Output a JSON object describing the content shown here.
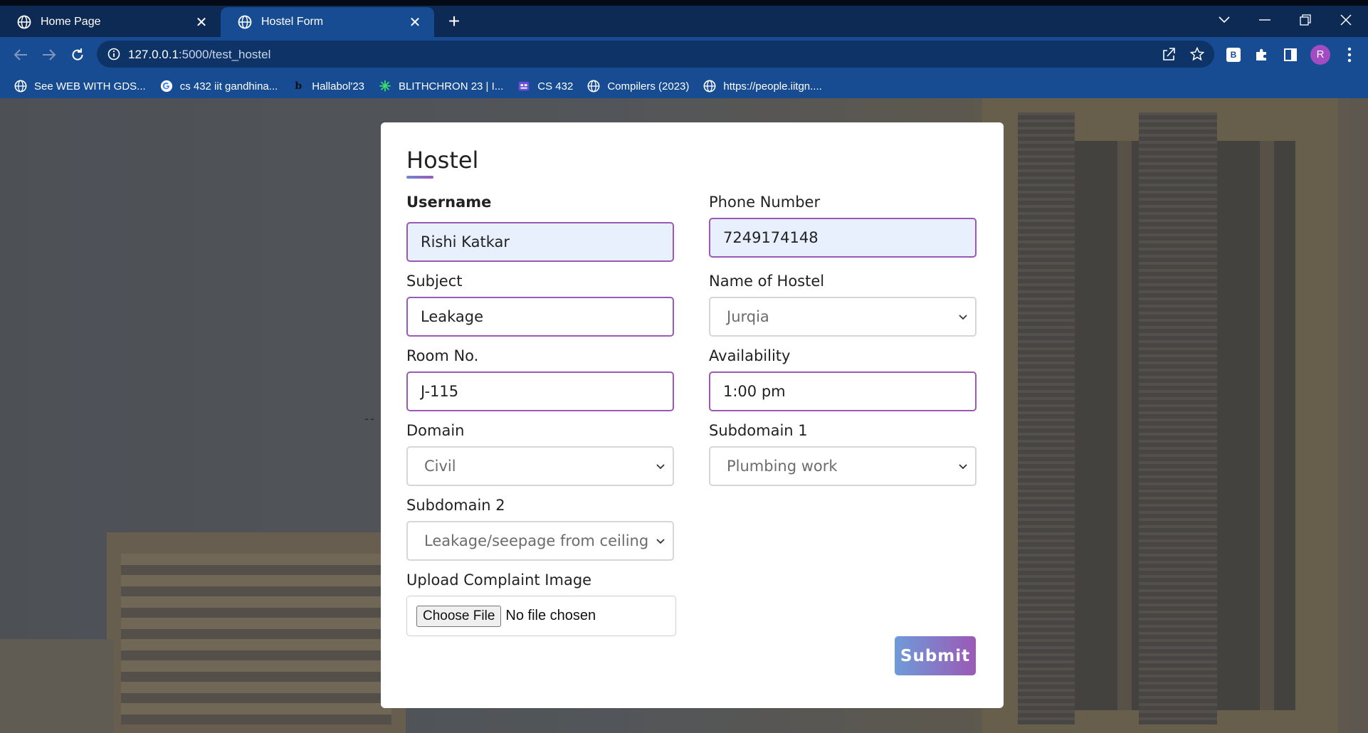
{
  "browser": {
    "tabs": [
      {
        "title": "Home Page",
        "active": false
      },
      {
        "title": "Hostel Form",
        "active": true
      }
    ],
    "url_host": "127.0.0.1",
    "url_rest": ":5000/test_hostel",
    "profile_initial": "R",
    "extension_badge": "B",
    "bookmarks": [
      {
        "label": "See WEB WITH GDS...",
        "icon": "globe-icon"
      },
      {
        "label": "cs 432 iit gandhina...",
        "icon": "google-icon"
      },
      {
        "label": "Hallabol'23",
        "icon": "b-logo-icon"
      },
      {
        "label": "BLITHCHRON 23 | I...",
        "icon": "star-burst-icon"
      },
      {
        "label": "CS 432",
        "icon": "board-icon"
      },
      {
        "label": "Compilers (2023)",
        "icon": "globe-icon"
      },
      {
        "label": "https://people.iitgn....",
        "icon": "globe-icon"
      }
    ]
  },
  "page": {
    "dashes": "--"
  },
  "form": {
    "title": "Hostel",
    "username_label": "Username",
    "username_value": "Rishi Katkar",
    "phone_label": "Phone Number",
    "phone_value": "7249174148",
    "subject_label": "Subject",
    "subject_value": "Leakage",
    "hostel_label": "Name of Hostel",
    "hostel_value": "Jurqia",
    "room_label": "Room No.",
    "room_value": "J-115",
    "availability_label": "Availability",
    "availability_value": "1:00 pm",
    "domain_label": "Domain",
    "domain_value": "Civil",
    "subdomain1_label": "Subdomain 1",
    "subdomain1_value": "Plumbing work",
    "subdomain2_label": "Subdomain 2",
    "subdomain2_value": "Leakage/seepage from ceiling",
    "upload_label": "Upload Complaint Image",
    "file_button": "Choose File",
    "file_status": "No file chosen",
    "submit_label": "Submit"
  },
  "colors": {
    "accent_purple": "#9b59b6",
    "accent_blue": "#6f86d6",
    "chrome_blue": "#174c92",
    "autofill_bg": "#e8f0fe"
  }
}
